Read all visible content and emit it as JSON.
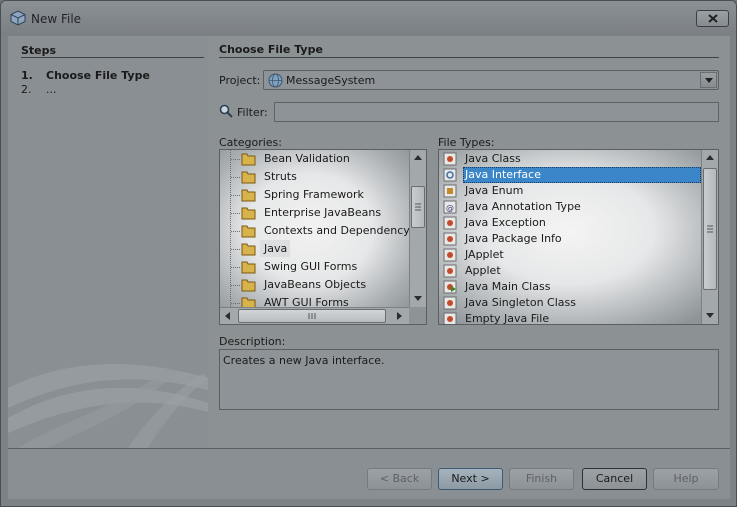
{
  "window": {
    "title": "New File"
  },
  "steps": {
    "title": "Steps",
    "items": [
      {
        "num": "1.",
        "label": "Choose File Type"
      },
      {
        "num": "2.",
        "label": "..."
      }
    ]
  },
  "main": {
    "title": "Choose File Type",
    "project_label": "Project:",
    "project_value": "MessageSystem",
    "filter_label": "Filter:",
    "filter_value": "",
    "categories_label": "Categories:",
    "filetypes_label": "File Types:",
    "description_label": "Description:",
    "description_text": "Creates a new Java interface."
  },
  "categories": [
    "Bean Validation",
    "Struts",
    "Spring Framework",
    "Enterprise JavaBeans",
    "Contexts and Dependency Injection",
    "Java",
    "Swing GUI Forms",
    "JavaBeans Objects",
    "AWT GUI Forms"
  ],
  "selected_category": "Java",
  "file_types": [
    "Java Class",
    "Java Interface",
    "Java Enum",
    "Java Annotation Type",
    "Java Exception",
    "Java Package Info",
    "JApplet",
    "Applet",
    "Java Main Class",
    "Java Singleton Class",
    "Empty Java File"
  ],
  "selected_file_type": "Java Interface",
  "buttons": {
    "back": "< Back",
    "next": "Next >",
    "finish": "Finish",
    "cancel": "Cancel",
    "help": "Help"
  },
  "colors": {
    "selection": "#3a86c8",
    "window_bg": "#7d8286"
  }
}
